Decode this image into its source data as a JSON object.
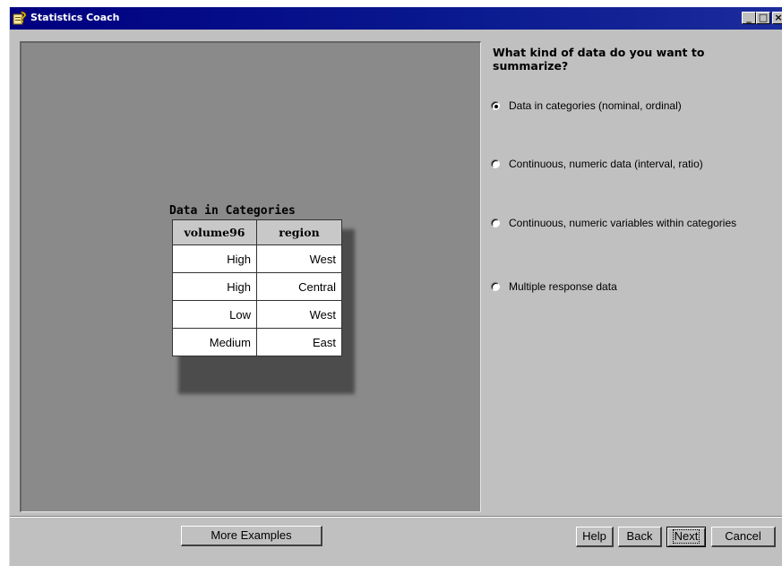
{
  "window": {
    "title": "Statistics Coach",
    "controls": {
      "minimize": "_",
      "maximize": "□",
      "close": "×"
    }
  },
  "example": {
    "title": "Data in Categories",
    "columns": [
      "volume96",
      "region"
    ],
    "rows": [
      [
        "High",
        "West"
      ],
      [
        "High",
        "Central"
      ],
      [
        "Low",
        "West"
      ],
      [
        "Medium",
        "East"
      ]
    ]
  },
  "question": "What kind of data do you want to summarize?",
  "options": [
    {
      "label": "Data in categories (nominal, ordinal)",
      "selected": true
    },
    {
      "label": "Continuous, numeric data (interval, ratio)",
      "selected": false
    },
    {
      "label": "Continuous, numeric variables within categories",
      "selected": false
    },
    {
      "label": "Multiple response data",
      "selected": false
    }
  ],
  "buttons": {
    "more_examples": "More Examples",
    "help": "Help",
    "back": "Back",
    "next": "Next",
    "cancel": "Cancel"
  },
  "colors": {
    "titlebar": "#000080",
    "face": "#c0c0c0",
    "example_panel": "#8a8a8a"
  },
  "icons": {
    "app": "statistics-coach-icon"
  }
}
